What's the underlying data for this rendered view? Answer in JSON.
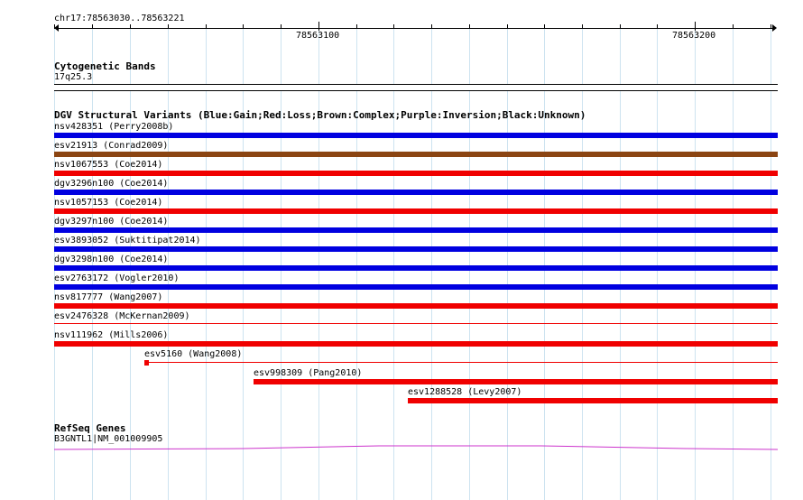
{
  "ruler": {
    "location": "chr17:78563030..78563221",
    "labels": [
      "78563100",
      "78563200"
    ]
  },
  "cytoband": {
    "title": "Cytogenetic Bands",
    "band": "17q25.3"
  },
  "dgv": {
    "title": "DGV Structural Variants (Blue:Gain;Red:Loss;Brown:Complex;Purple:Inversion;Black:Unknown)",
    "colors": {
      "gain": "#0000e0",
      "loss": "#f00000",
      "complex": "#8b4513",
      "inversion": "#800080",
      "unknown": "#000000"
    },
    "variants": [
      {
        "label": "nsv428351 (Perry2008b)",
        "type": "gain"
      },
      {
        "label": "esv21913 (Conrad2009)",
        "type": "complex"
      },
      {
        "label": "nsv1067553 (Coe2014)",
        "type": "loss"
      },
      {
        "label": "dgv3296n100 (Coe2014)",
        "type": "gain"
      },
      {
        "label": "nsv1057153 (Coe2014)",
        "type": "loss"
      },
      {
        "label": "dgv3297n100 (Coe2014)",
        "type": "gain"
      },
      {
        "label": "esv3893052 (Suktitipat2014)",
        "type": "gain"
      },
      {
        "label": "dgv3298n100 (Coe2014)",
        "type": "gain"
      },
      {
        "label": "esv2763172 (Vogler2010)",
        "type": "gain"
      },
      {
        "label": "nsv817777 (Wang2007)",
        "type": "loss"
      },
      {
        "label": "esv2476328 (McKernan2009)",
        "type": "loss"
      },
      {
        "label": "nsv111962 (Mills2006)",
        "type": "loss"
      },
      {
        "label": "esv5160 (Wang2008)",
        "type": "loss"
      },
      {
        "label": "esv998309 (Pang2010)",
        "type": "loss"
      },
      {
        "label": "esv1288528 (Levy2007)",
        "type": "loss"
      }
    ]
  },
  "refseq": {
    "title": "RefSeq Genes",
    "gene": "B3GNTL1|NM_001009905",
    "color": "#cc33cc"
  },
  "colors": {
    "gridline": "#cde3f0"
  }
}
